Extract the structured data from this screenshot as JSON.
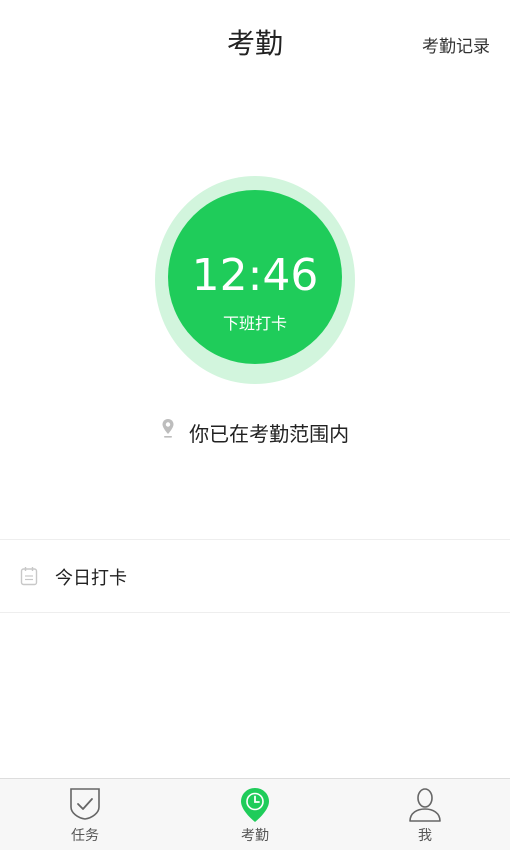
{
  "header": {
    "title": "考勤",
    "records_link": "考勤记录"
  },
  "punch": {
    "time": "12:46",
    "label": "下班打卡",
    "accent_color": "#1fcc5a",
    "ring_color": "#d2f5dd"
  },
  "location": {
    "icon": "location-pin-icon",
    "status_text": "你已在考勤范围内"
  },
  "today": {
    "icon": "calendar-icon",
    "label": "今日打卡"
  },
  "tabbar": {
    "tabs": [
      {
        "label": "任务",
        "icon": "task-shield-icon",
        "active": false
      },
      {
        "label": "考勤",
        "icon": "attendance-clock-pin-icon",
        "active": true
      },
      {
        "label": "我",
        "icon": "profile-icon",
        "active": false
      }
    ]
  }
}
